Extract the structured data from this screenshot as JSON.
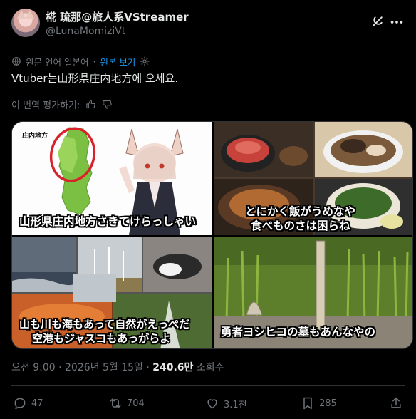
{
  "author": {
    "display_name": "椛 琉那@旅人系VStreamer",
    "handle": "@LunaMomiziVt"
  },
  "translation": {
    "note": "원문 언어 일본어",
    "show_original": "원본 보기"
  },
  "tweet": {
    "text": "Vtuber는山形県庄内地方에 오세요."
  },
  "rating": {
    "prompt": "이 번역 평가하기:"
  },
  "media": {
    "image1": {
      "map_label": "庄内地方",
      "caption": "山形県庄内地方さきてけらっしゃい"
    },
    "image2": {
      "caption_line1": "とにかく飯がうめなや",
      "caption_line2": "食べものさは困らね"
    },
    "image3": {
      "caption_line1": "山も川も海もあって自然がえっぺだ",
      "caption_line2": "空港もジャスコもあっがらよ"
    },
    "image4": {
      "caption": "勇者ヨシヒコの墓もあんなやの"
    }
  },
  "meta": {
    "time_date": "오전 9:00 · 2026년 5월 15일 · ",
    "views_count": "240.6만",
    "views_label": " 조회수"
  },
  "actions": {
    "replies": "47",
    "reposts": "704",
    "likes": "3.1천",
    "bookmarks": "285"
  },
  "colors": {
    "background": "#000000",
    "text": "#e7e9ea",
    "secondary": "#71767b",
    "link": "#1d9bf0"
  }
}
